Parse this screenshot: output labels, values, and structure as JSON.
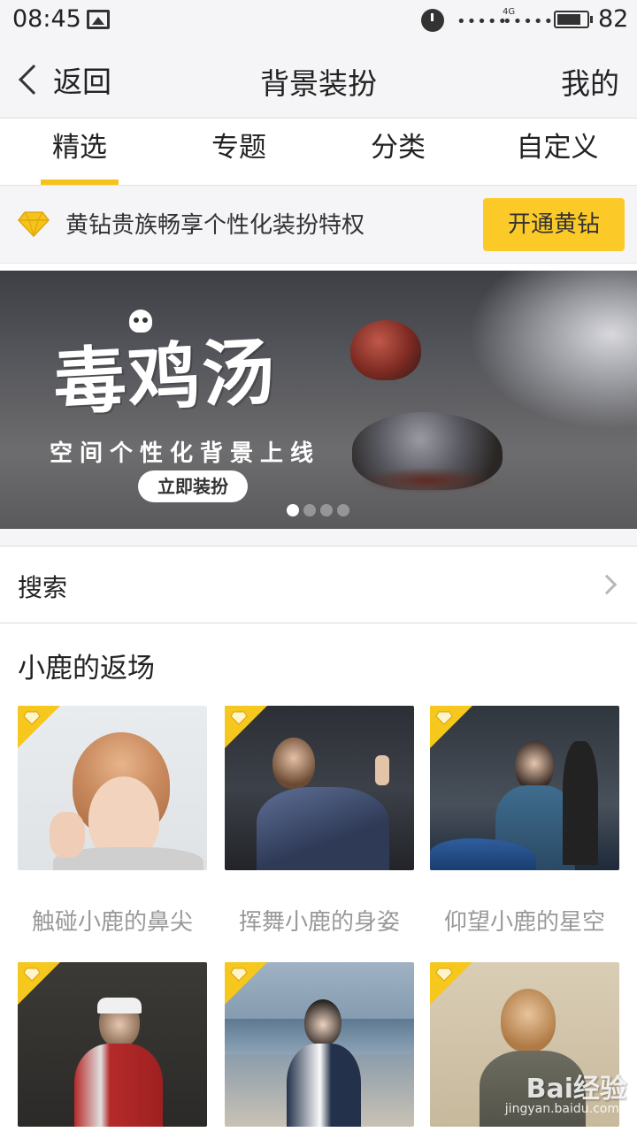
{
  "status_bar": {
    "time": "08:45",
    "network": "4G",
    "signal_dots": "•••••",
    "battery": "82",
    "battery_level": 0.82
  },
  "nav": {
    "back_label": "返回",
    "title": "背景装扮",
    "right_label": "我的"
  },
  "tabs": [
    {
      "label": "精选",
      "active": true
    },
    {
      "label": "专题",
      "active": false
    },
    {
      "label": "分类",
      "active": false
    },
    {
      "label": "自定义",
      "active": false
    }
  ],
  "promo": {
    "text": "黄钻贵族畅享个性化装扮特权",
    "button": "开通黄钻",
    "icon": "diamond-icon"
  },
  "banner": {
    "title": "毒鸡汤",
    "subtitle": "空间个性化背景上线",
    "button": "立即装扮",
    "slide_count": 4,
    "active_slide": 1
  },
  "search": {
    "label": "搜索"
  },
  "section": {
    "title": "小鹿的返场",
    "items": [
      {
        "name": "触碰小鹿的鼻尖"
      },
      {
        "name": "挥舞小鹿的身姿"
      },
      {
        "name": "仰望小鹿的星空"
      },
      {
        "name": ""
      },
      {
        "name": ""
      },
      {
        "name": ""
      }
    ]
  },
  "watermark": {
    "brand": "Bai经验",
    "url": "jingyan.baidu.com"
  },
  "colors": {
    "accent": "#f6c31a",
    "promo_button": "#fcca28",
    "background": "#f5f5f7",
    "caption": "#999999"
  }
}
